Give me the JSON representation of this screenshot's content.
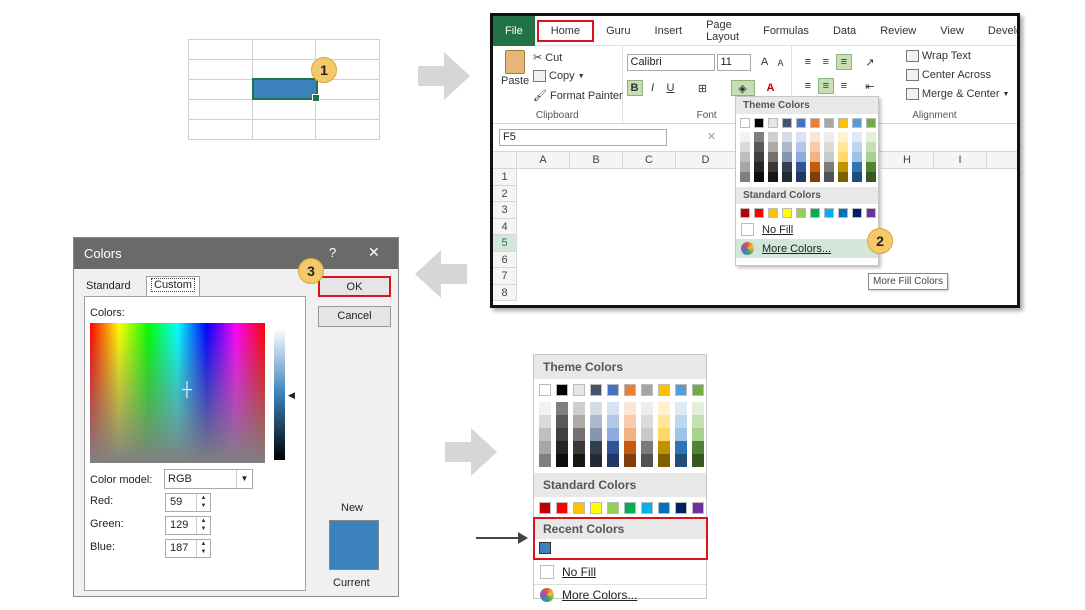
{
  "badges": [
    "1",
    "2",
    "3"
  ],
  "excel": {
    "tabs": [
      "File",
      "Home",
      "Guru",
      "Insert",
      "Page Layout",
      "Formulas",
      "Data",
      "Review",
      "View",
      "Develo"
    ],
    "clipboard": {
      "paste": "Paste",
      "cut": "Cut",
      "copy": "Copy",
      "format_painter": "Format Painter",
      "label": "Clipboard"
    },
    "font": {
      "name": "Calibri",
      "size": "11",
      "bold": "B",
      "italic": "I",
      "underline": "U",
      "label": "Font"
    },
    "alignment": {
      "wrap": "Wrap Text",
      "center_across": "Center Across",
      "merge": "Merge & Center",
      "label": "Alignment"
    },
    "name_box": "F5",
    "columns": [
      "A",
      "B",
      "C",
      "D",
      "H",
      "I"
    ],
    "rows": [
      "1",
      "2",
      "3",
      "4",
      "5",
      "6",
      "7",
      "8"
    ]
  },
  "dropdown": {
    "theme_header": "Theme Colors",
    "standard_header": "Standard Colors",
    "recent_header": "Recent Colors",
    "no_fill": "No Fill",
    "more_colors": "More Colors...",
    "tooltip": "More Fill Colors",
    "theme_top": [
      "#ffffff",
      "#000000",
      "#e7e6e6",
      "#44546a",
      "#4472c4",
      "#ed7d31",
      "#a5a5a5",
      "#ffc000",
      "#5b9bd5",
      "#70ad47"
    ],
    "theme_tints": [
      [
        "#f2f2f2",
        "#d9d9d9",
        "#bfbfbf",
        "#a6a6a6",
        "#808080"
      ],
      [
        "#7f7f7f",
        "#595959",
        "#404040",
        "#262626",
        "#0d0d0d"
      ],
      [
        "#d0cece",
        "#aeaaaa",
        "#757171",
        "#3a3838",
        "#171616"
      ],
      [
        "#d6dce4",
        "#adb9ca",
        "#8497b0",
        "#333f4f",
        "#222a35"
      ],
      [
        "#d9e2f3",
        "#b4c7e7",
        "#8faadc",
        "#2f5597",
        "#203864"
      ],
      [
        "#fbe5d6",
        "#f8cbad",
        "#f4b183",
        "#c55a11",
        "#843c0c"
      ],
      [
        "#ededed",
        "#dbdbdb",
        "#c9c9c9",
        "#7b7b7b",
        "#525252"
      ],
      [
        "#fff2cc",
        "#ffe699",
        "#ffd966",
        "#bf9000",
        "#7f6000"
      ],
      [
        "#deebf7",
        "#bdd7ee",
        "#9dc3e6",
        "#2e75b6",
        "#1f4e79"
      ],
      [
        "#e2f0d9",
        "#c5e0b4",
        "#a9d18e",
        "#548235",
        "#385723"
      ]
    ],
    "standard": [
      "#c00000",
      "#ff0000",
      "#ffc000",
      "#ffff00",
      "#92d050",
      "#00b050",
      "#00b0f0",
      "#0070c0",
      "#002060",
      "#7030a0"
    ],
    "recent": [
      "#3b81bb"
    ]
  },
  "dialog": {
    "title": "Colors",
    "help": "?",
    "close": "✕",
    "tab_standard": "Standard",
    "tab_custom": "Custom",
    "ok": "OK",
    "cancel": "Cancel",
    "colors_label": "Colors:",
    "model_label": "Color model:",
    "model_value": "RGB",
    "red_label": "Red:",
    "green_label": "Green:",
    "blue_label": "Blue:",
    "red": "59",
    "green": "129",
    "blue": "187",
    "new_label": "New",
    "current_label": "Current",
    "new_color": "#3b81bb"
  }
}
